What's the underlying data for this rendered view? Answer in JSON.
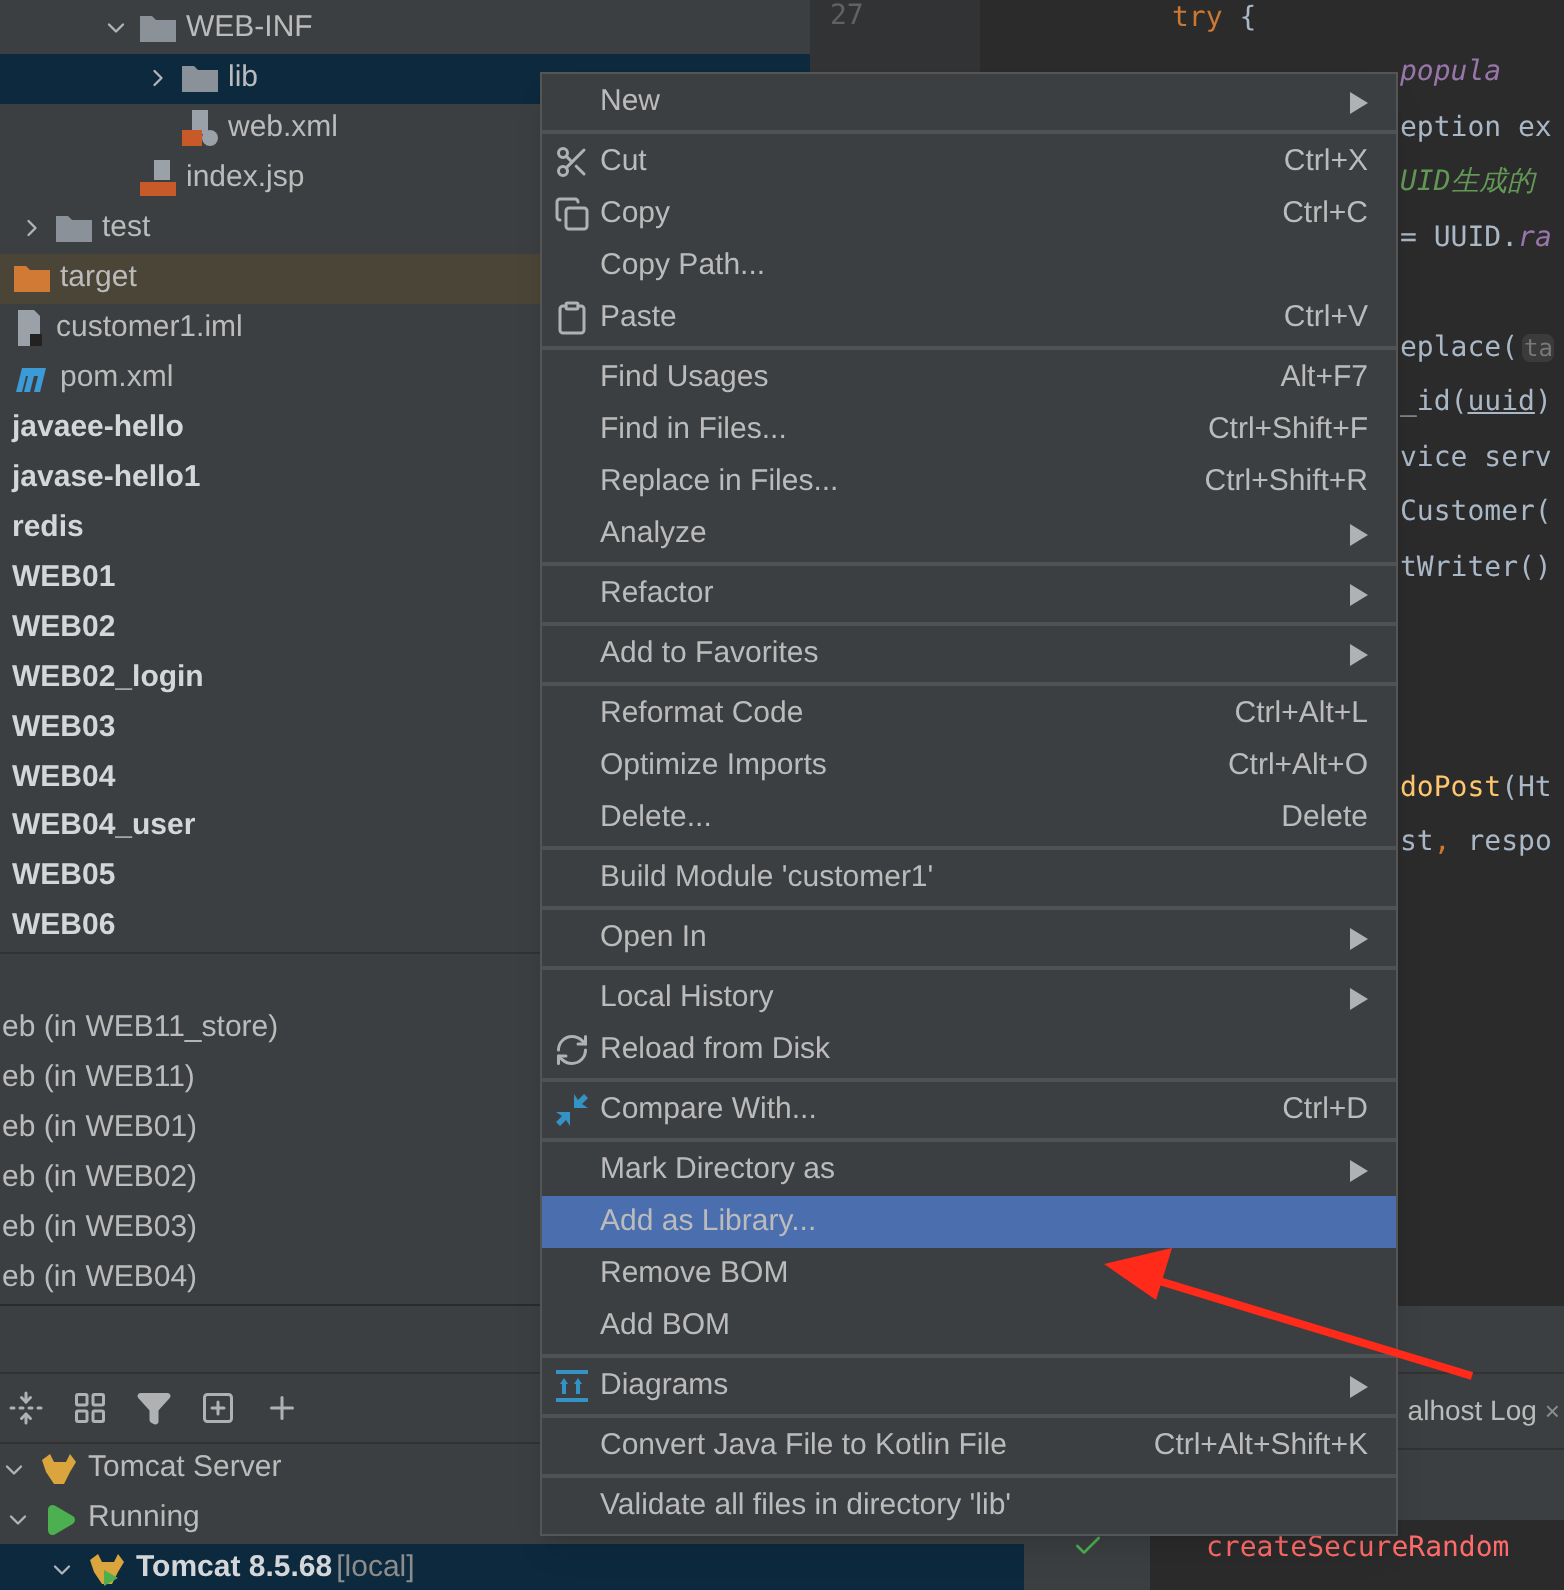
{
  "project_tree": {
    "items": [
      {
        "children": [
          {
            "children": [
              {
                "children": [
                  {
                    "label": "WEB-INF",
                    "kind": "folder",
                    "expanded": true,
                    "selected": false,
                    "children": [
                      {
                        "label": "lib",
                        "kind": "folder",
                        "expanded": false,
                        "selected": true
                      },
                      {
                        "label": "web.xml",
                        "kind": "xml",
                        "selected": false
                      }
                    ]
                  },
                  {
                    "label": "index.jsp",
                    "kind": "jsp",
                    "selected": false
                  }
                ]
              }
            ]
          },
          {
            "label": "test",
            "kind": "folder",
            "expanded": false,
            "selected": false
          }
        ]
      },
      {
        "label": "target",
        "kind": "excluded",
        "selected": false
      },
      {
        "label": "customer1.iml",
        "kind": "iml",
        "selected": false
      },
      {
        "label": "pom.xml",
        "kind": "maven",
        "selected": false
      },
      {
        "label": "javaee-hello",
        "kind": "module",
        "selected": false
      },
      {
        "label": "javase-hello1",
        "kind": "module",
        "selected": false
      },
      {
        "label": "redis",
        "kind": "module",
        "selected": false
      },
      {
        "label": "WEB01",
        "kind": "module",
        "selected": false
      },
      {
        "label": "WEB02",
        "kind": "module",
        "selected": false
      },
      {
        "label": "WEB02_login",
        "kind": "module",
        "selected": false
      },
      {
        "label": "WEB03",
        "kind": "module",
        "selected": false
      },
      {
        "label": "WEB04",
        "kind": "module",
        "selected": false
      },
      {
        "label": "WEB04_user",
        "kind": "module",
        "selected": false
      },
      {
        "label": "WEB05",
        "kind": "module",
        "selected": false
      },
      {
        "label": "WEB06",
        "kind": "module",
        "selected": false
      }
    ]
  },
  "artifacts": [
    "eb (in WEB11_store)",
    "eb (in WEB11)",
    "eb (in WEB01)",
    "eb (in WEB02)",
    "eb (in WEB03)",
    "eb (in WEB04)"
  ],
  "editor": {
    "lines": [
      {
        "number": "27",
        "kind": "block",
        "tokens": [
          {
            "kind": "keyword",
            "text": "try"
          },
          {
            "kind": "plain",
            "text": " {"
          }
        ]
      },
      {
        "kind": "tail",
        "tokens": [
          {
            "kind": "static",
            "text": " popula"
          }
        ]
      },
      {
        "kind": "tail",
        "tokens": [
          {
            "kind": "plain",
            "text": "eption ex"
          }
        ]
      },
      {
        "kind": "tail",
        "tokens": [
          {
            "kind": "comment",
            "text": "UID生成的"
          }
        ]
      },
      {
        "kind": "tail",
        "tokens": [
          {
            "kind": "plain",
            "text": "= UUID."
          },
          {
            "kind": "static",
            "text": "ra"
          }
        ]
      },
      {
        "kind": "blank"
      },
      {
        "kind": "tail",
        "tokens": [
          {
            "kind": "plain",
            "text": "eplace("
          },
          {
            "kind": "hint",
            "text": "ta"
          }
        ]
      },
      {
        "kind": "tail",
        "tokens": [
          {
            "kind": "plain",
            "text": "_id("
          },
          {
            "kind": "underlined",
            "text": "uuid"
          },
          {
            "kind": "plain",
            "text": ")"
          }
        ]
      },
      {
        "kind": "tail",
        "tokens": [
          {
            "kind": "plain",
            "text": "vice serv"
          }
        ]
      },
      {
        "kind": "tail",
        "tokens": [
          {
            "kind": "plain",
            "text": "Customer("
          }
        ]
      },
      {
        "kind": "tail",
        "tokens": [
          {
            "kind": "plain",
            "text": "tWriter()"
          }
        ]
      },
      {
        "kind": "blank"
      },
      {
        "kind": "blank"
      },
      {
        "kind": "blank"
      },
      {
        "kind": "tail",
        "tokens": [
          {
            "kind": "method",
            "text": "doPost"
          },
          {
            "kind": "plain",
            "text": "(Ht"
          }
        ]
      },
      {
        "kind": "tail",
        "tokens": [
          {
            "kind": "plain",
            "text": "st"
          },
          {
            "kind": "keyword",
            "text": ","
          },
          {
            "kind": "plain",
            "text": " respo"
          }
        ]
      }
    ]
  },
  "services": {
    "tree": [
      {
        "label": "Tomcat Server",
        "kind": "server",
        "expanded": true,
        "selected": false,
        "children": [
          {
            "label": "Running",
            "kind": "running",
            "expanded": true,
            "selected": false,
            "children": [
              {
                "label": "Tomcat 8.5.68",
                "location": "[local]",
                "kind": "instance",
                "expanded": true,
                "selected": true
              }
            ]
          }
        ]
      }
    ]
  },
  "log_tab": {
    "label": "alhost Log",
    "close": "×"
  },
  "console": {
    "error_text": "createSecureRandom"
  },
  "context_menu": [
    {
      "kind": "item",
      "label": "New",
      "submenu": true,
      "selected": false
    },
    {
      "kind": "separator"
    },
    {
      "kind": "cut",
      "label": "Cut",
      "shortcut": "Ctrl+X",
      "selected": false
    },
    {
      "kind": "copy",
      "label": "Copy",
      "shortcut": "Ctrl+C",
      "selected": false
    },
    {
      "kind": "item",
      "label": "Copy Path...",
      "selected": false
    },
    {
      "kind": "paste",
      "label": "Paste",
      "shortcut": "Ctrl+V",
      "selected": false
    },
    {
      "kind": "separator"
    },
    {
      "kind": "item",
      "label": "Find Usages",
      "shortcut": "Alt+F7",
      "selected": false
    },
    {
      "kind": "item",
      "label": "Find in Files...",
      "shortcut": "Ctrl+Shift+F",
      "selected": false
    },
    {
      "kind": "item",
      "label": "Replace in Files...",
      "shortcut": "Ctrl+Shift+R",
      "selected": false
    },
    {
      "kind": "item",
      "label": "Analyze",
      "submenu": true,
      "selected": false
    },
    {
      "kind": "separator"
    },
    {
      "kind": "item",
      "label": "Refactor",
      "submenu": true,
      "selected": false
    },
    {
      "kind": "separator"
    },
    {
      "kind": "item",
      "label": "Add to Favorites",
      "submenu": true,
      "selected": false
    },
    {
      "kind": "separator"
    },
    {
      "kind": "item",
      "label": "Reformat Code",
      "shortcut": "Ctrl+Alt+L",
      "selected": false
    },
    {
      "kind": "item",
      "label": "Optimize Imports",
      "shortcut": "Ctrl+Alt+O",
      "selected": false
    },
    {
      "kind": "item",
      "label": "Delete...",
      "shortcut": "Delete",
      "selected": false
    },
    {
      "kind": "separator"
    },
    {
      "kind": "item",
      "label": "Build Module 'customer1'",
      "selected": false
    },
    {
      "kind": "separator"
    },
    {
      "kind": "item",
      "label": "Open In",
      "submenu": true,
      "selected": false
    },
    {
      "kind": "separator"
    },
    {
      "kind": "item",
      "label": "Local History",
      "submenu": true,
      "selected": false
    },
    {
      "kind": "reload",
      "label": "Reload from Disk",
      "selected": false
    },
    {
      "kind": "separator"
    },
    {
      "kind": "compare",
      "label": "Compare With...",
      "shortcut": "Ctrl+D",
      "selected": false
    },
    {
      "kind": "separator"
    },
    {
      "kind": "item",
      "label": "Mark Directory as",
      "submenu": true,
      "selected": false
    },
    {
      "kind": "item",
      "label": "Add as Library...",
      "selected": true
    },
    {
      "kind": "item",
      "label": "Remove BOM",
      "selected": false
    },
    {
      "kind": "item",
      "label": "Add BOM",
      "selected": false
    },
    {
      "kind": "separator"
    },
    {
      "kind": "diagram",
      "label": "Diagrams",
      "submenu": true,
      "selected": false
    },
    {
      "kind": "separator"
    },
    {
      "kind": "item",
      "label": "Convert Java File to Kotlin File",
      "shortcut": "Ctrl+Alt+Shift+K",
      "selected": false
    },
    {
      "kind": "separator"
    },
    {
      "kind": "item",
      "label": "Validate all files in directory 'lib'",
      "selected": false
    }
  ],
  "annotation": {
    "kind": "arrow"
  }
}
